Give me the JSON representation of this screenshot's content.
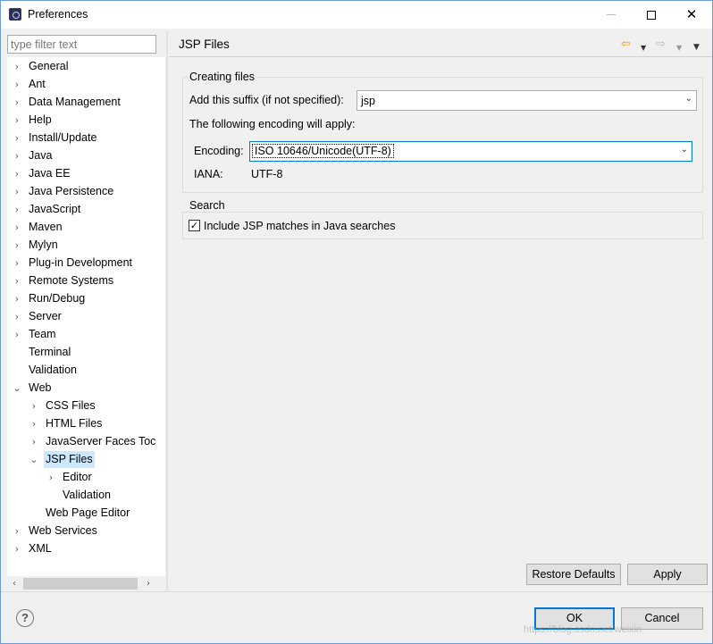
{
  "window": {
    "title": "Preferences",
    "controls": {
      "minimize": "—",
      "maximize": "□",
      "close": "✕"
    }
  },
  "sidebar": {
    "filter_placeholder": "type filter text",
    "tree": [
      {
        "label": "General",
        "depth": 0,
        "chevron": "›"
      },
      {
        "label": "Ant",
        "depth": 0,
        "chevron": "›"
      },
      {
        "label": "Data Management",
        "depth": 0,
        "chevron": "›"
      },
      {
        "label": "Help",
        "depth": 0,
        "chevron": "›"
      },
      {
        "label": "Install/Update",
        "depth": 0,
        "chevron": "›"
      },
      {
        "label": "Java",
        "depth": 0,
        "chevron": "›"
      },
      {
        "label": "Java EE",
        "depth": 0,
        "chevron": "›"
      },
      {
        "label": "Java Persistence",
        "depth": 0,
        "chevron": "›"
      },
      {
        "label": "JavaScript",
        "depth": 0,
        "chevron": "›"
      },
      {
        "label": "Maven",
        "depth": 0,
        "chevron": "›"
      },
      {
        "label": "Mylyn",
        "depth": 0,
        "chevron": "›"
      },
      {
        "label": "Plug-in Development",
        "depth": 0,
        "chevron": "›"
      },
      {
        "label": "Remote Systems",
        "depth": 0,
        "chevron": "›"
      },
      {
        "label": "Run/Debug",
        "depth": 0,
        "chevron": "›"
      },
      {
        "label": "Server",
        "depth": 0,
        "chevron": "›"
      },
      {
        "label": "Team",
        "depth": 0,
        "chevron": "›"
      },
      {
        "label": "Terminal",
        "depth": 0,
        "chevron": ""
      },
      {
        "label": "Validation",
        "depth": 0,
        "chevron": ""
      },
      {
        "label": "Web",
        "depth": 0,
        "chevron": "⌄"
      },
      {
        "label": "CSS Files",
        "depth": 1,
        "chevron": "›"
      },
      {
        "label": "HTML Files",
        "depth": 1,
        "chevron": "›"
      },
      {
        "label": "JavaServer Faces Toc",
        "depth": 1,
        "chevron": "›"
      },
      {
        "label": "JSP Files",
        "depth": 1,
        "chevron": "⌄",
        "selected": true
      },
      {
        "label": "Editor",
        "depth": 2,
        "chevron": "›"
      },
      {
        "label": "Validation",
        "depth": 2,
        "chevron": ""
      },
      {
        "label": "Web Page Editor",
        "depth": 1,
        "chevron": ""
      },
      {
        "label": "Web Services",
        "depth": 0,
        "chevron": "›"
      },
      {
        "label": "XML",
        "depth": 0,
        "chevron": "›"
      }
    ],
    "scroll_left": "‹",
    "scroll_right": "›"
  },
  "page": {
    "title": "JSP Files",
    "nav": {
      "back": "⇦",
      "back_menu": "▼",
      "forward": "⇨",
      "forward_menu": "▼",
      "view_menu": "▼"
    },
    "creating_files": {
      "group_label": "Creating files",
      "suffix_label": "Add this suffix (if not specified):",
      "suffix_value": "jsp",
      "encoding_note": "The following encoding will apply:",
      "encoding_label": "Encoding:",
      "encoding_value": "ISO 10646/Unicode(UTF-8)",
      "iana_label": "IANA:",
      "iana_value": "UTF-8"
    },
    "search": {
      "group_label": "Search",
      "checkbox_label": "Include JSP matches in Java searches",
      "checkbox_mark": "✓",
      "checked": true
    },
    "dropdown_glyph": "⌄",
    "buttons": {
      "restore_defaults": "Restore Defaults",
      "apply": "Apply"
    }
  },
  "footer": {
    "help": "?",
    "ok": "OK",
    "cancel": "Cancel",
    "watermark": "https://blog.csdn.net/weixin"
  },
  "colors": {
    "accent": "#0078d7",
    "selection": "#cce8ff",
    "back_arrow": "#e0a020"
  }
}
